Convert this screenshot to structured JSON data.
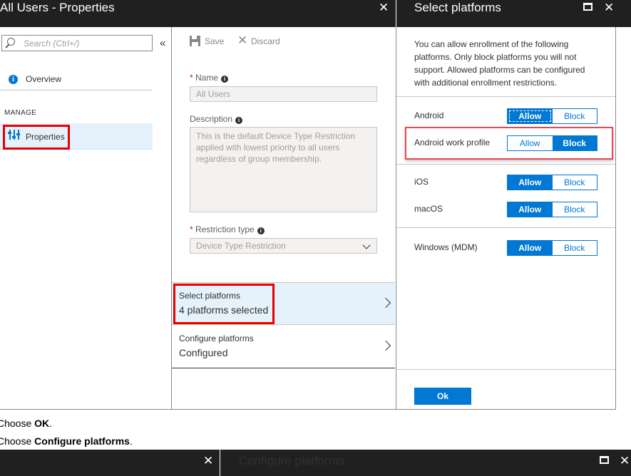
{
  "window_left": {
    "title": "All Users - Properties",
    "close_glyph": "✕"
  },
  "window_right": {
    "title": "Select platforms",
    "maximize_icon": "maximize-icon",
    "close_glyph": "✕"
  },
  "search": {
    "placeholder": "Search (Ctrl+/)"
  },
  "collapse_glyph": "«",
  "nav": {
    "overview_label": "Overview",
    "manage_header": "MANAGE",
    "properties_label": "Properties"
  },
  "toolbar": {
    "save_label": "Save",
    "discard_label": "Discard"
  },
  "form": {
    "name_label": "Name",
    "name_value": "All Users",
    "description_label": "Description",
    "description_value": "This is the default Device Type Restriction applied with lowest priority to all users regardless of group membership.",
    "restriction_label": "Restriction type",
    "restriction_value": "Device Type Restriction",
    "required_mark": "*"
  },
  "select_platforms_nav": {
    "title": "Select platforms",
    "value": "4 platforms selected"
  },
  "configure_platforms_nav": {
    "title": "Configure platforms",
    "value": "Configured"
  },
  "platforms": {
    "description": "You can allow enrollment of the following platforms. Only block platforms you will not support. Allowed platforms can be configured with additional enrollment restrictions.",
    "allow_label": "Allow",
    "block_label": "Block",
    "items": [
      {
        "name": "Android",
        "state": "Allow"
      },
      {
        "name": "Android work profile",
        "state": "Block"
      },
      {
        "name": "iOS",
        "state": "Allow"
      },
      {
        "name": "macOS",
        "state": "Allow"
      },
      {
        "name": "Windows (MDM)",
        "state": "Allow"
      }
    ],
    "ok_label": "Ok"
  },
  "instructions": {
    "step1_prefix": "Choose ",
    "step1_bold": "OK",
    "step1_suffix": ".",
    "step2_prefix": "Choose ",
    "step2_bold": "Configure platforms",
    "step2_suffix": "."
  },
  "bottom_window": {
    "title": "Configure platforms",
    "close_glyph": "✕"
  },
  "colors": {
    "accent": "#0078d4",
    "highlight_red": "#e60000",
    "titlebar": "#202020"
  }
}
